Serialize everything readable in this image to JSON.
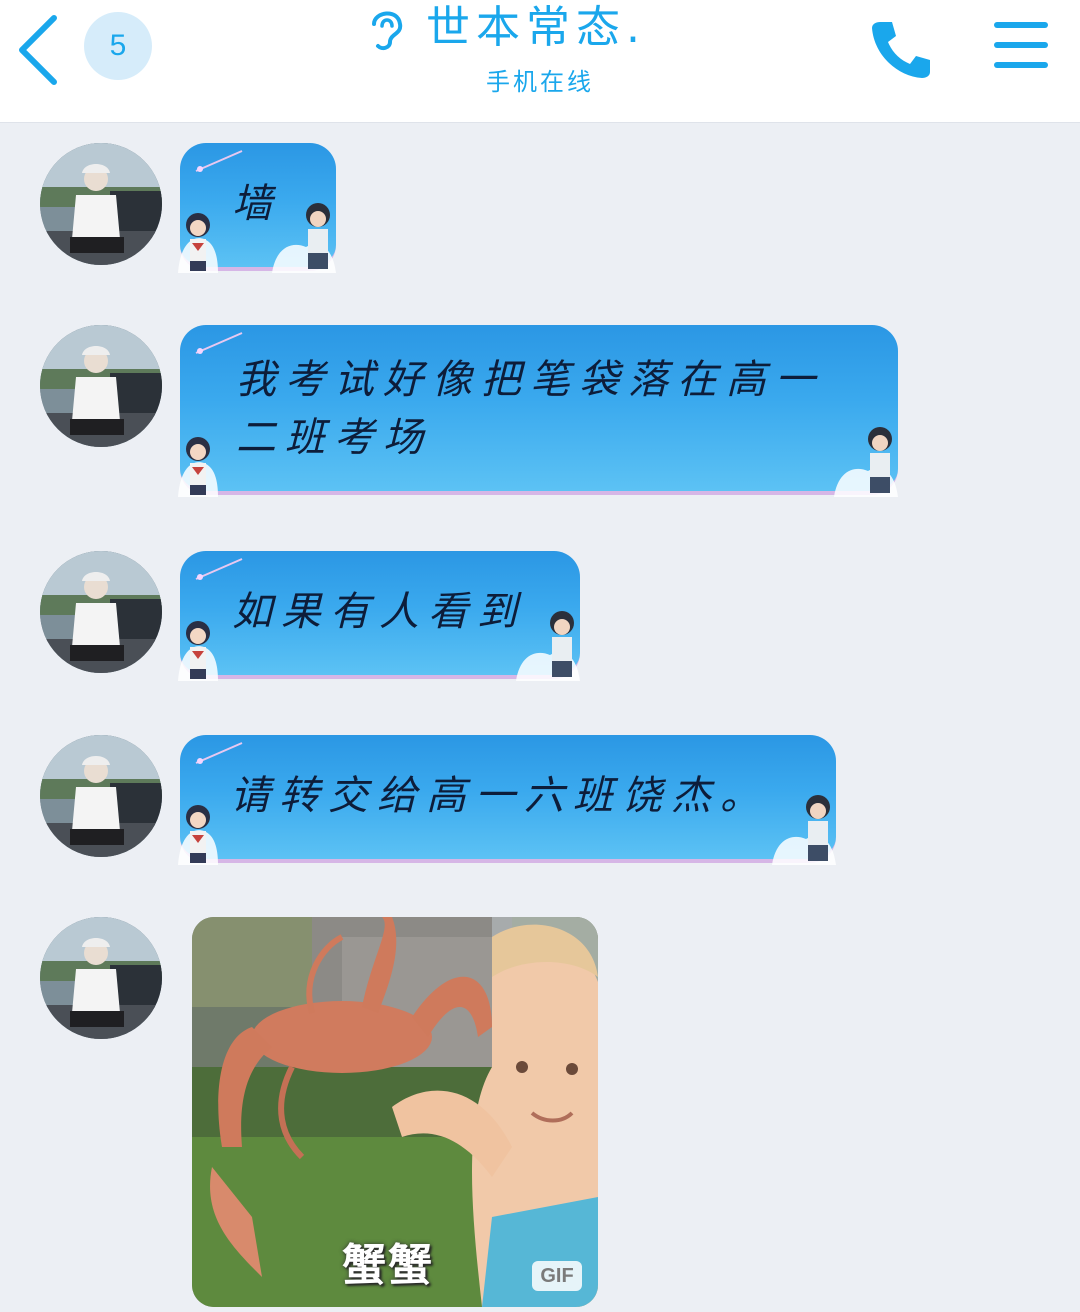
{
  "header": {
    "unread_count": "5",
    "title": "世本常态.",
    "subtitle": "手机在线",
    "accent_color": "#1aa7ec",
    "icons": {
      "back": "chevron-left-icon",
      "listen": "ear-icon",
      "call": "phone-icon",
      "menu": "menu-icon"
    }
  },
  "messages": [
    {
      "type": "text",
      "text": "墙"
    },
    {
      "type": "text",
      "lines": [
        "我考试好像把笔袋落在高一",
        "二班考场"
      ]
    },
    {
      "type": "text",
      "text": "如果有人看到"
    },
    {
      "type": "text",
      "text": "请转交给高一六班饶杰。"
    },
    {
      "type": "gif",
      "caption": "蟹蟹",
      "badge": "GIF"
    }
  ]
}
